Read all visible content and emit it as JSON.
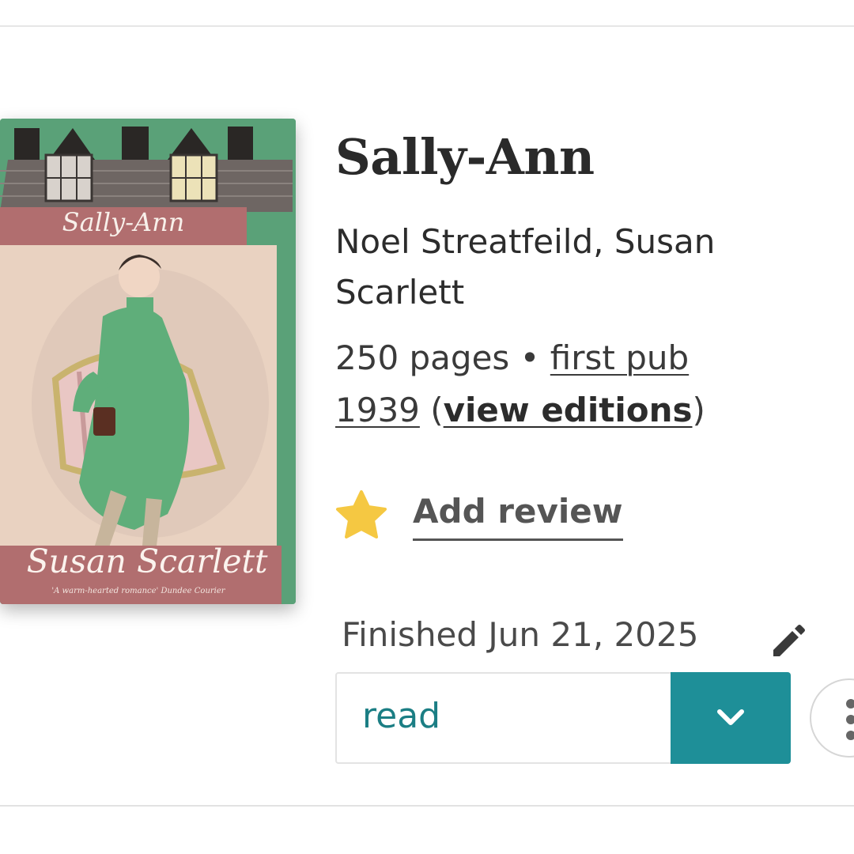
{
  "book": {
    "title": "Sally-Ann",
    "authors": "Noel Streatfeild, Susan Scarlett",
    "pages": "250 pages",
    "separator": "•",
    "first_pub": "first pub 1939",
    "view_editions": "view editions"
  },
  "cover": {
    "title_text": "Sally-Ann",
    "author_text": "Susan Scarlett",
    "quote_text": "'A warm-hearted romance' Dundee Courier",
    "colors": {
      "background": "#5aa178",
      "banner": "#b16e6f",
      "roof": "#6e6663"
    }
  },
  "review": {
    "icon": "star-icon",
    "label": "Add review",
    "star_color": "#f5c842"
  },
  "shelf": {
    "finished_text": "Finished Jun 21, 2025",
    "edit_icon": "pencil-icon",
    "status_value": "read",
    "toggle_icon": "chevron-down-icon",
    "more_icon": "more-vertical-icon",
    "accent_color": "#1e8f98"
  }
}
